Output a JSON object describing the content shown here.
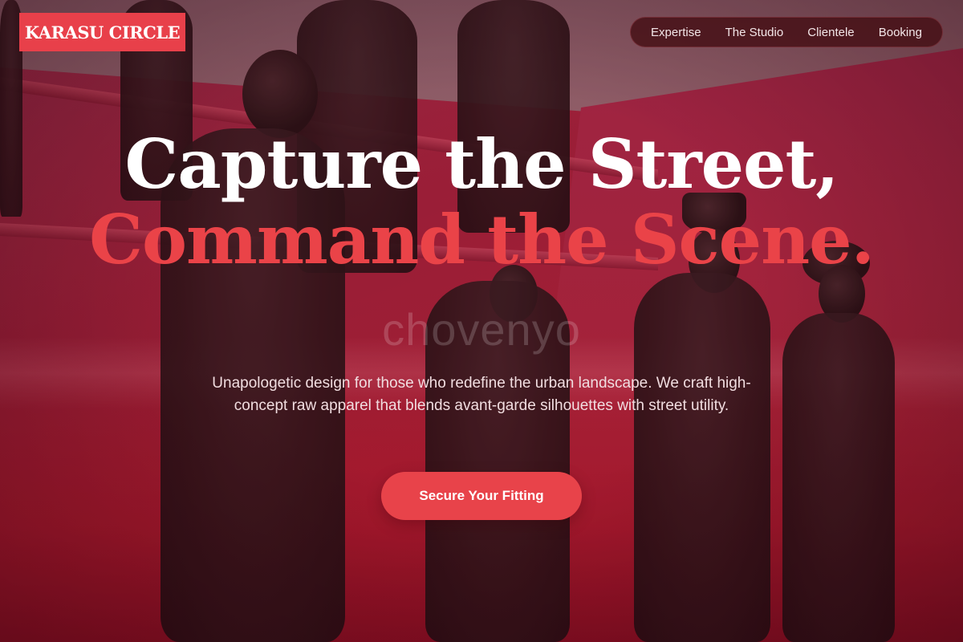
{
  "brand": {
    "logo_text": "KARASU CIRCLE",
    "logo_bg_color": "#e8404a"
  },
  "nav": {
    "items": [
      {
        "label": "Expertise"
      },
      {
        "label": "The Studio"
      },
      {
        "label": "Clientele"
      },
      {
        "label": "Booking"
      }
    ]
  },
  "hero": {
    "headline_line1": "Capture the Street,",
    "headline_line2": "Command the Scene.",
    "ghost_text": "chovenyo",
    "subtext": "Unapologetic design for those who redefine the urban landscape. We craft high-concept raw apparel that blends avant-garde silhouettes with street utility.",
    "cta_label": "Secure Your Fitting",
    "accent_color": "#ea4348",
    "background": "mannequins in dark garments against a red gallery wall"
  }
}
